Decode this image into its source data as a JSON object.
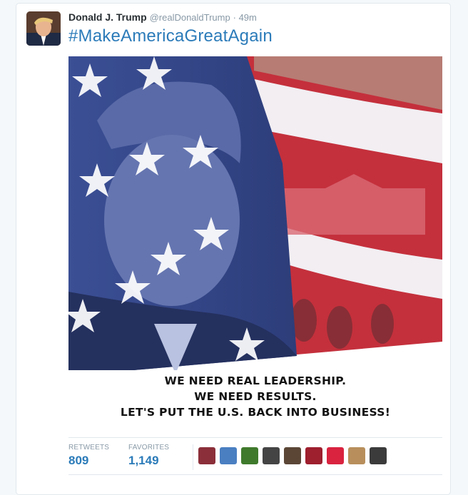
{
  "tweet": {
    "author_name": "Donald J. Trump",
    "handle": "@realDonaldTrump",
    "time": "· 49m",
    "text": "#MakeAmericaGreatAgain",
    "image": {
      "caption_lines": [
        "WE NEED REAL LEADERSHIP.",
        "WE NEED RESULTS.",
        "LET'S PUT THE U.S. BACK INTO BUSINESS!"
      ]
    }
  },
  "stats": {
    "retweets_label": "RETWEETS",
    "retweets_value": "809",
    "favorites_label": "FAVORITES",
    "favorites_value": "1,149"
  },
  "favoriters": [
    {
      "name": "user-avatar-1",
      "color": "#8b2f3a"
    },
    {
      "name": "user-avatar-2",
      "color": "#4a7fc1"
    },
    {
      "name": "user-avatar-3",
      "color": "#3f7a2c"
    },
    {
      "name": "user-avatar-4",
      "color": "#444444"
    },
    {
      "name": "user-avatar-5",
      "color": "#5b4636"
    },
    {
      "name": "user-avatar-6",
      "color": "#9e1f2e"
    },
    {
      "name": "user-avatar-7",
      "color": "#d9233f"
    },
    {
      "name": "user-avatar-8",
      "color": "#b88f5c"
    },
    {
      "name": "user-avatar-9",
      "color": "#3b3b3b"
    }
  ],
  "colors": {
    "link": "#2b7bb9",
    "text": "#292f33",
    "muted": "#8899a6"
  }
}
